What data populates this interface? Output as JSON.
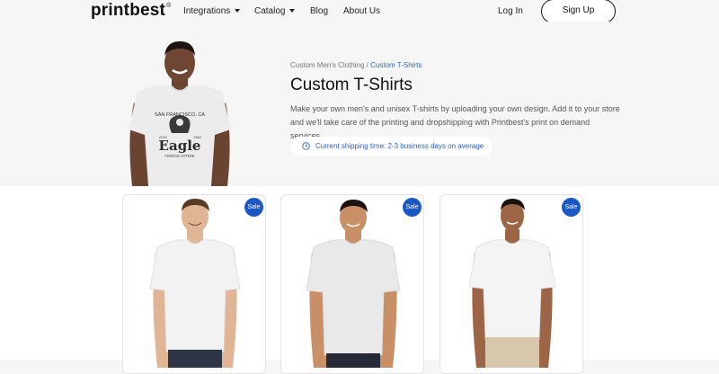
{
  "header": {
    "logo": "printbest",
    "logo_mark": "®",
    "nav": [
      {
        "label": "Integrations",
        "has_dropdown": true
      },
      {
        "label": "Catalog",
        "has_dropdown": true
      },
      {
        "label": "Blog",
        "has_dropdown": false
      },
      {
        "label": "About Us",
        "has_dropdown": false
      }
    ],
    "login_label": "Log In",
    "signup_label": "Sign Up"
  },
  "hero": {
    "breadcrumb": {
      "parent": "Custom Men's Clothing",
      "separator": " / ",
      "current": "Custom T-Shirts"
    },
    "title": "Custom T-Shirts",
    "description": "Make your own men's and unisex T-shirts by uploading your own design. Add it to your store and we'll take care of the printing and dropshipping with Printbest's print on demand services.",
    "shipping_notice": "Current shipping time: 2-3 business days on average",
    "shipping_icon": "clock-icon",
    "model_shirt_print": {
      "top_text": "SAN FRANCISCO, CA",
      "left_num": "2010",
      "right_num": "1964",
      "main": "Eagle",
      "bottom_text": "FIERCE ATTIRE"
    }
  },
  "products": [
    {
      "badge": "Sale",
      "shirt_color": "#f2f2f2",
      "skin": "#e0b596",
      "hair": "#5a3a22"
    },
    {
      "badge": "Sale",
      "shirt_color": "#e9e9ea",
      "skin": "#c98f66",
      "hair": "#1c1410"
    },
    {
      "badge": "Sale",
      "shirt_color": "#f4f4f4",
      "skin": "#9c6646",
      "hair": "#1a120d"
    }
  ],
  "colors": {
    "accent_blue": "#1b58c4",
    "link_blue": "#3566c6",
    "background": "#f6f6f6"
  }
}
